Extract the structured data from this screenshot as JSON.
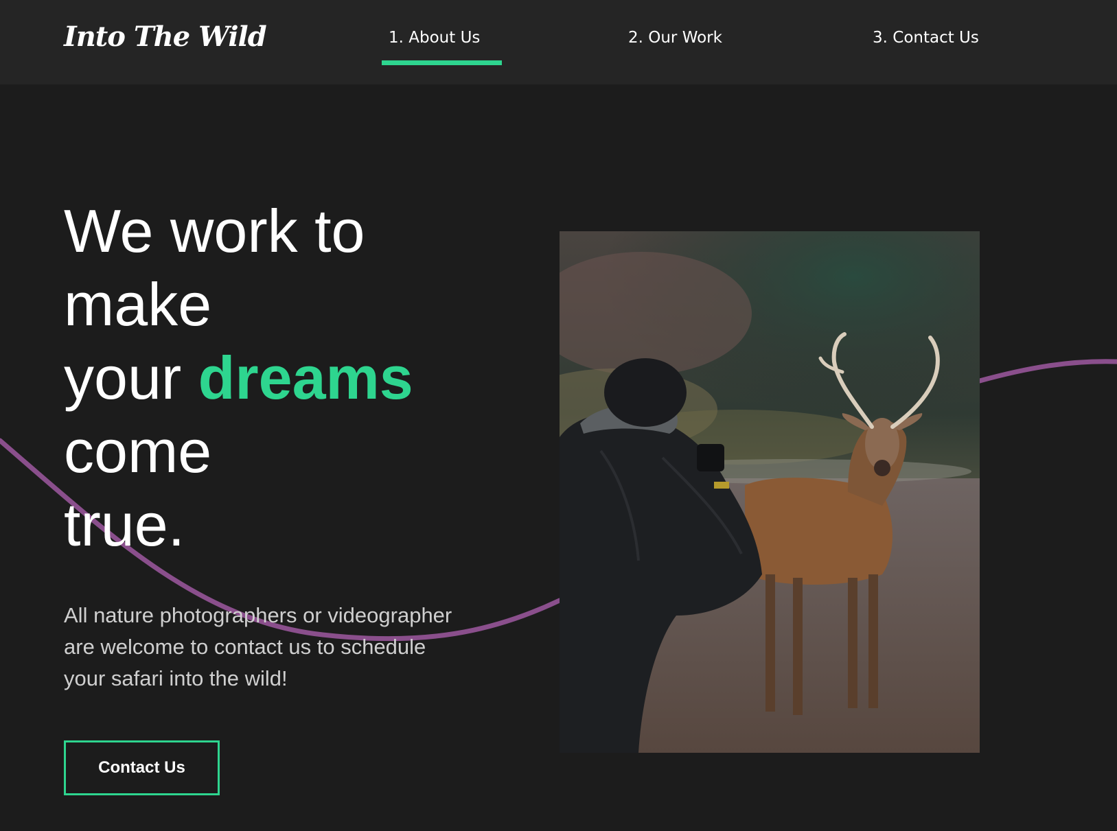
{
  "header": {
    "logo": "Into The Wild",
    "nav": [
      {
        "label": "1. About Us",
        "active": true
      },
      {
        "label": "2. Our Work",
        "active": false
      },
      {
        "label": "3. Contact Us",
        "active": false
      }
    ]
  },
  "hero": {
    "headline": {
      "line1": "We work to",
      "line2": "make",
      "line3_prefix": "your ",
      "line3_accent": "dreams",
      "line4": "come",
      "line5": "true."
    },
    "subtext": [
      "All nature photographers or videographer",
      "are welcome to contact us to schedule",
      "your safari into the wild!"
    ],
    "cta_label": "Contact Us",
    "image_icon": "photographer-with-deer-photo"
  },
  "colors": {
    "background": "#1c1c1c",
    "header_background": "#252525",
    "accent": "#2ed58f",
    "wave": "#8a4f8c",
    "text": "#ffffff",
    "subtext": "#cfcfcf"
  }
}
